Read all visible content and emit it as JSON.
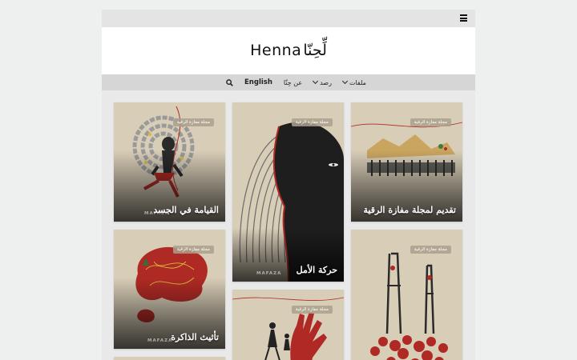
{
  "site": {
    "logo_latin": "Henna",
    "logo_arabic": "لِّحِنّا"
  },
  "nav": {
    "items": [
      "ملفات",
      "رصد",
      "عن حِنّا"
    ],
    "language": "English"
  },
  "cards": [
    {
      "title": "القيامة في الجسد",
      "badge": "مجلة مفازة الرقية",
      "watermark": "MAFAZA"
    },
    {
      "title": "حركة الأمل",
      "badge": "مجلة مفازة الرقية",
      "watermark": "MAFAZA"
    },
    {
      "title": "تقديم لمجلة مفازة الرقية",
      "badge": "مجلة مفازة الرقية",
      "watermark": ""
    },
    {
      "title": "تأثيث الذاكرة",
      "badge": "مجلة مفازة الرقية",
      "watermark": "MAFAZA"
    },
    {
      "title": "",
      "badge": "مجلة مفازة الرقية",
      "watermark": ""
    },
    {
      "title": "",
      "badge": "مجلة مفازة الرقية",
      "watermark": ""
    }
  ],
  "colors": {
    "background": "#eef0ef",
    "nav_bar": "#d6d6d6",
    "card_paper": "#d8cdb7",
    "accent_red": "#b02a25"
  }
}
